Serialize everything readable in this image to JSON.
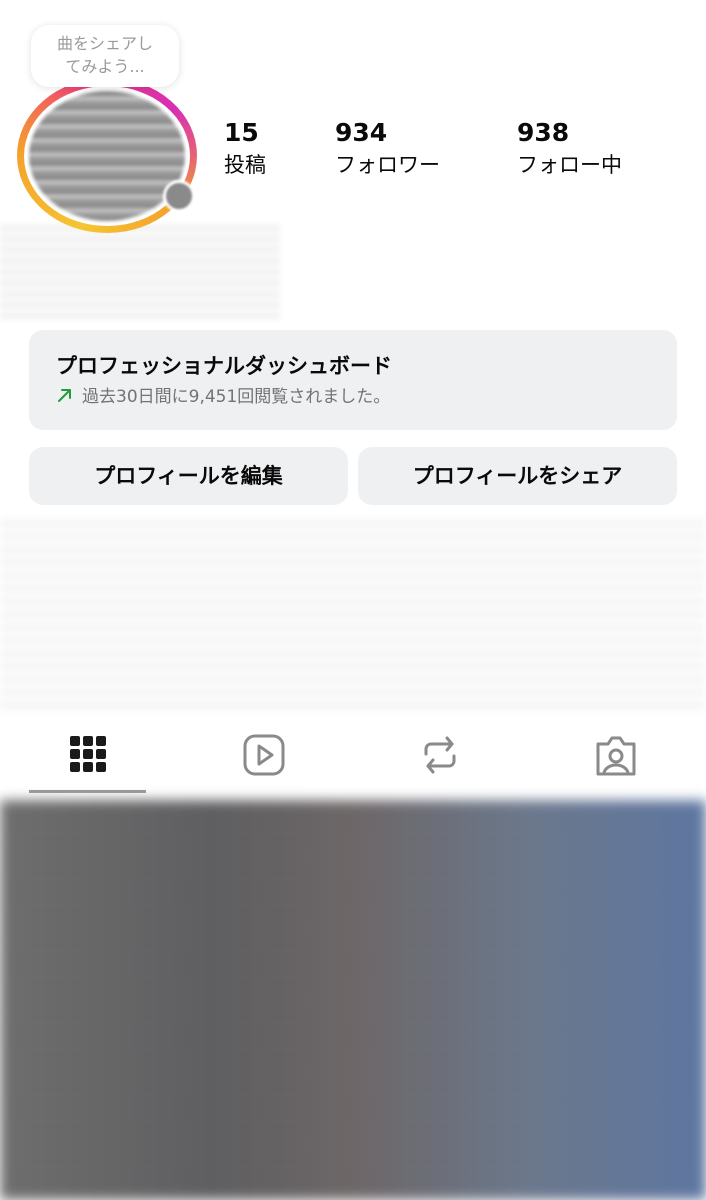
{
  "note": {
    "line1": "曲をシェアし",
    "line2": "てみよう..."
  },
  "stats": {
    "posts": {
      "count": "15",
      "label": "投稿"
    },
    "followers": {
      "count": "934",
      "label": "フォロワー"
    },
    "following": {
      "count": "938",
      "label": "フォロー中"
    }
  },
  "dashboard": {
    "title": "プロフェッショナルダッシュボード",
    "subtitle": "過去30日間に9,451回閲覧されました。"
  },
  "buttons": {
    "edit_profile": "プロフィールを編集",
    "share_profile": "プロフィールをシェア"
  },
  "tabs": [
    {
      "icon": "grid-icon",
      "selected": true
    },
    {
      "icon": "reels-icon",
      "selected": false
    },
    {
      "icon": "repost-icon",
      "selected": false
    },
    {
      "icon": "tagged-icon",
      "selected": false
    }
  ],
  "colors": {
    "accent_trend": "#1f9d3a",
    "button_bg": "#eff0f2",
    "ring_gradient": [
      "#f6c533",
      "#f4a12c",
      "#ef3a7d",
      "#d72fb4"
    ]
  }
}
